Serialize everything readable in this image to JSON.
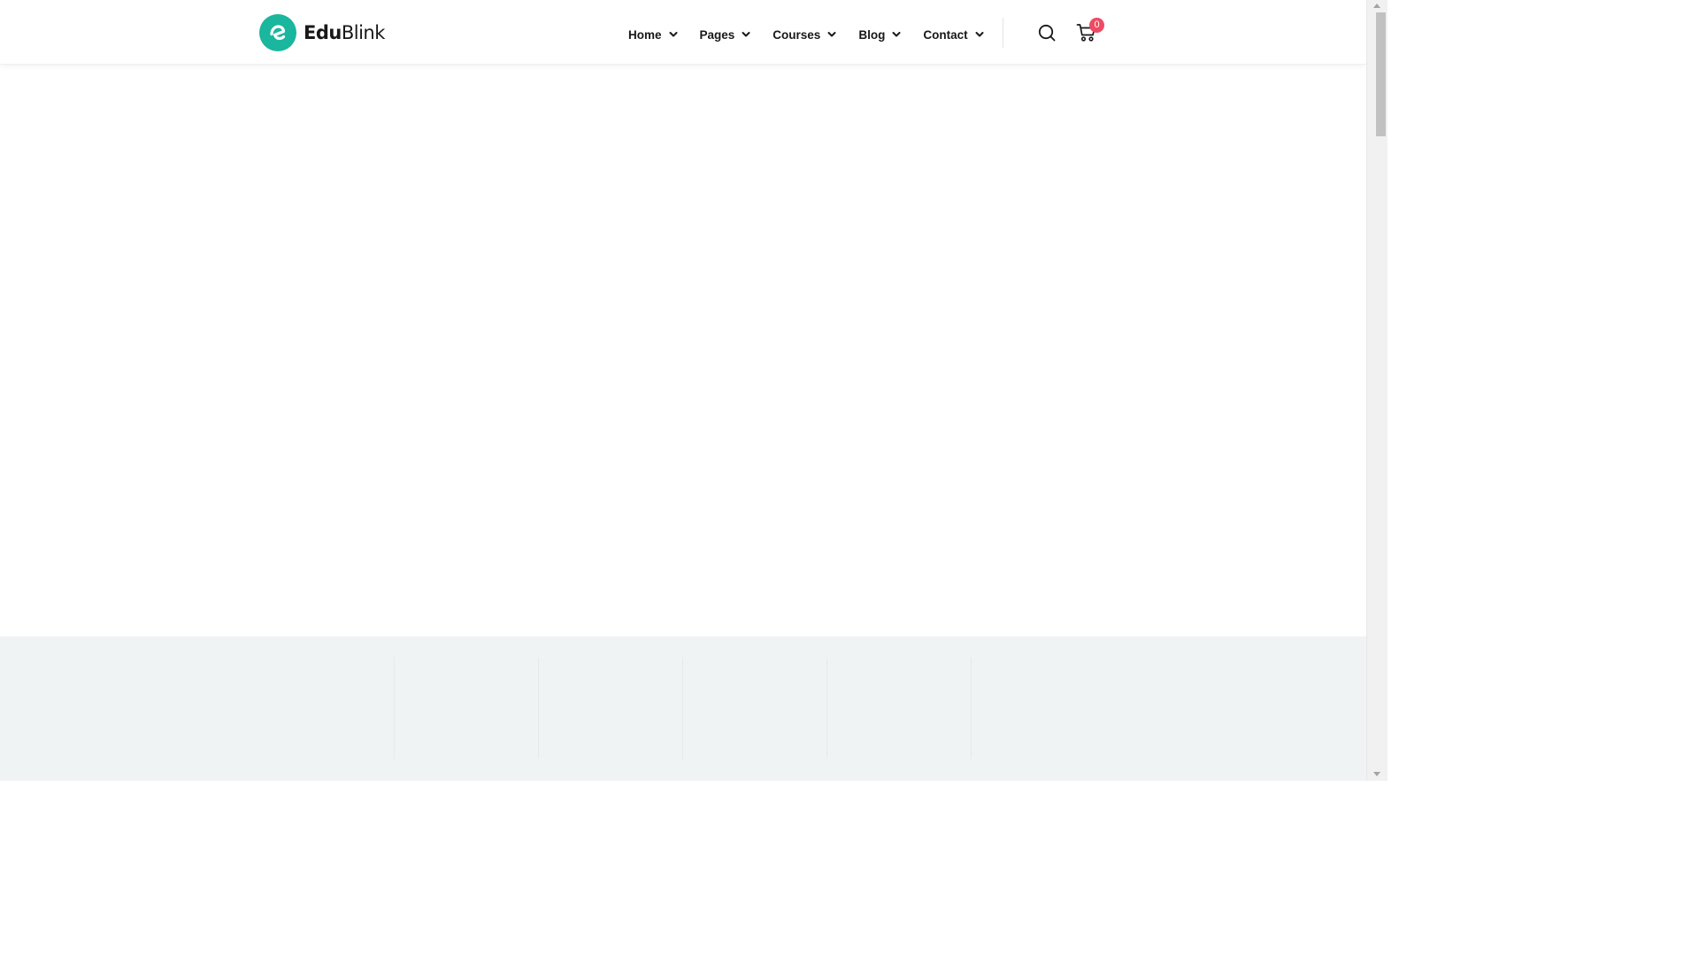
{
  "brand": {
    "name_bold": "Edu",
    "name_light": "Blink",
    "accent_color": "#1ab69d",
    "logo_icon": "edublink-logo-icon"
  },
  "nav": {
    "items": [
      {
        "label": "Home",
        "icon": "chevron-down-icon"
      },
      {
        "label": "Pages",
        "icon": "chevron-down-icon"
      },
      {
        "label": "Courses",
        "icon": "chevron-down-icon"
      },
      {
        "label": "Blog",
        "icon": "chevron-down-icon"
      },
      {
        "label": "Contact",
        "icon": "chevron-down-icon"
      }
    ]
  },
  "header_actions": {
    "search_icon": "search-icon",
    "cart_icon": "cart-icon",
    "cart_count": "0",
    "badge_color": "#ee4a62"
  },
  "colors": {
    "text": "#181818",
    "band_background": "#eff3f4"
  }
}
